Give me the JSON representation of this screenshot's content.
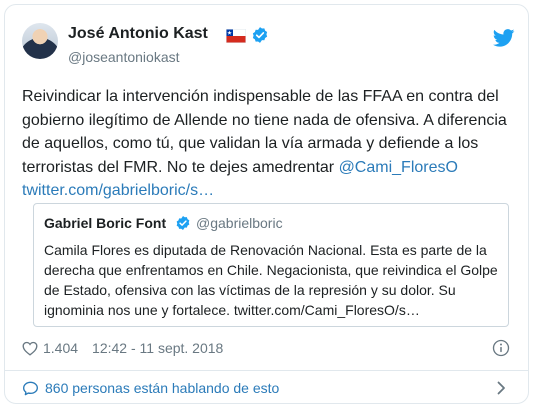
{
  "author": {
    "name": "José Antonio Kast",
    "handle": "@joseantoniokast"
  },
  "tweet": {
    "text": "Reivindicar la intervención indispensable de las FFAA en contra del gobierno ilegítimo de Allende no tiene nada de ofensiva. A diferencia de aquellos, como tú, que validan la vía armada y defiende a los terroristas del FMR. No te dejes amedrentar ",
    "mention": "@Cami_FloresO",
    "link": "twitter.com/gabrielboric/s…"
  },
  "quoted": {
    "name": "Gabriel Boric Font",
    "handle": "@gabrielboric",
    "text": "Camila Flores es diputada de Renovación Nacional. Esta es parte de la derecha que enfrentamos en Chile. Negacionista, que reivindica el Golpe de Estado, ofensiva con las víctimas de la represión y su dolor. Su ignominia nos une y fortalece. twitter.com/Cami_FloresO/s…"
  },
  "meta": {
    "likes": "1.404",
    "timestamp": "12:42 - 11 sept. 2018"
  },
  "footer": {
    "talking": "860 personas están hablando de esto"
  },
  "colors": {
    "link": "#2b7bb9",
    "verified": "#1da1f2",
    "muted": "#697882",
    "border": "#e1e8ed"
  },
  "icons": [
    "verified-badge-icon",
    "chile-flag-icon",
    "twitter-bird-icon",
    "heart-icon",
    "info-icon",
    "speech-bubble-icon",
    "chevron-right-icon"
  ]
}
